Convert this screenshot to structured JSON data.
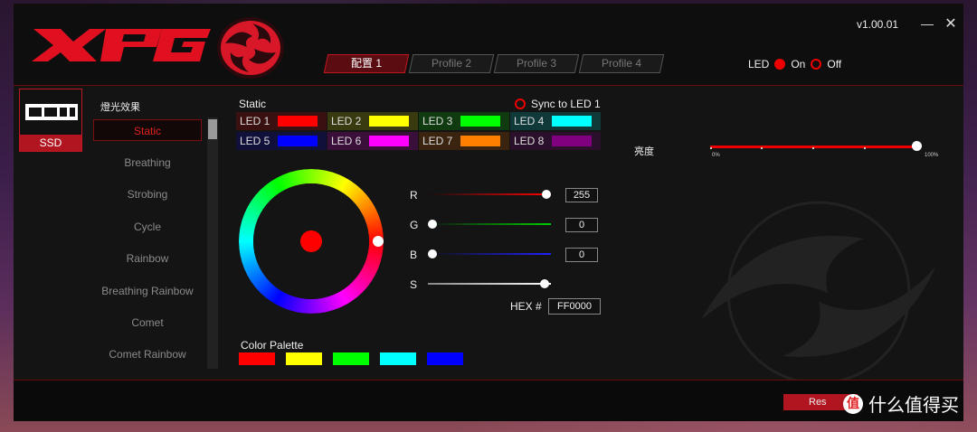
{
  "header": {
    "brand": "XPG",
    "version": "v1.00.01",
    "minimize_glyph": "—",
    "close_glyph": "✕",
    "tabs": [
      {
        "label": "配置 1",
        "active": true
      },
      {
        "label": "Profile 2",
        "active": false
      },
      {
        "label": "Profile 3",
        "active": false
      },
      {
        "label": "Profile 4",
        "active": false
      }
    ],
    "led_label": "LED",
    "on_label": "On",
    "off_label": "Off"
  },
  "device": {
    "label": "SSD",
    "icon": "ssd-icon"
  },
  "effects": {
    "title": "燈光效果",
    "items": [
      "Static",
      "Breathing",
      "Strobing",
      "Cycle",
      "Rainbow",
      "Breathing Rainbow",
      "Comet",
      "Comet Rainbow"
    ],
    "selected": "Static"
  },
  "static_panel": {
    "title": "Static",
    "sync_label": "Sync to LED 1",
    "leds": [
      {
        "label": "LED 1",
        "color": "#ff0000",
        "bg": "#3a1010"
      },
      {
        "label": "LED 2",
        "color": "#ffff00",
        "bg": "#3a3a10"
      },
      {
        "label": "LED 3",
        "color": "#00ff00",
        "bg": "#103a10"
      },
      {
        "label": "LED 4",
        "color": "#00ffff",
        "bg": "#10393a"
      },
      {
        "label": "LED 5",
        "color": "#0000ff",
        "bg": "#10103a"
      },
      {
        "label": "LED 6",
        "color": "#ff00ff",
        "bg": "#3a103a"
      },
      {
        "label": "LED 7",
        "color": "#ff8000",
        "bg": "#3a2410"
      },
      {
        "label": "LED 8",
        "color": "#800080",
        "bg": "#2a102a"
      }
    ],
    "r_label": "R",
    "g_label": "G",
    "b_label": "B",
    "s_label": "S",
    "r_value": "255",
    "g_value": "0",
    "b_value": "0",
    "hex_label": "HEX #",
    "hex_value": "FF0000",
    "palette_title": "Color Palette",
    "palette": [
      "#ff0000",
      "#ffff00",
      "#00ff00",
      "#00ffff",
      "#0000ff"
    ]
  },
  "brightness": {
    "label": "亮度",
    "min_label": "0%",
    "max_label": "100%",
    "value_percent": 100
  },
  "footer": {
    "reset_label": "Res",
    "overlay_badge": "值",
    "overlay_text": "什么值得买"
  },
  "colors": {
    "accent": "#e00000",
    "accent_dark": "#b01520"
  }
}
